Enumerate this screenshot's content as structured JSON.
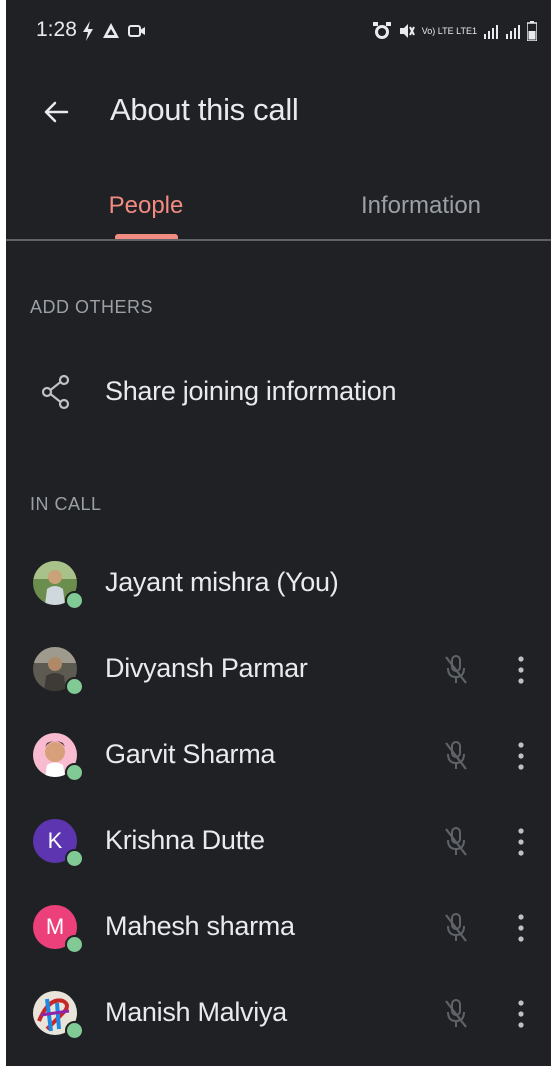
{
  "status_bar": {
    "time": "1:28",
    "network_label": "Vo) LTE LTE1"
  },
  "app_bar": {
    "title": "About this call",
    "back_icon": "arrow-back-icon"
  },
  "tabs": [
    {
      "label": "People",
      "selected": true
    },
    {
      "label": "Information",
      "selected": false
    }
  ],
  "add_others": {
    "heading": "ADD OTHERS",
    "share_label": "Share joining information",
    "share_icon": "share-icon"
  },
  "in_call": {
    "heading": "IN CALL",
    "participants": [
      {
        "name": "Jayant mishra (You)",
        "avatar": "photo",
        "muted": false,
        "show_menu": false
      },
      {
        "name": "Divyansh Parmar",
        "avatar": "photo",
        "muted": true,
        "show_menu": true
      },
      {
        "name": "Garvit Sharma",
        "avatar": "photo",
        "muted": true,
        "show_menu": true
      },
      {
        "name": "Krishna Dutte",
        "avatar": "K",
        "avatar_color": "#5e35b1",
        "muted": true,
        "show_menu": true
      },
      {
        "name": "Mahesh sharma",
        "avatar": "M",
        "avatar_color": "#ec407a",
        "muted": true,
        "show_menu": true
      },
      {
        "name": "Manish Malviya",
        "avatar": "photo",
        "muted": true,
        "show_menu": true
      }
    ]
  },
  "colors": {
    "background": "#202124",
    "accent": "#f28b82",
    "presence": "#81c995",
    "secondary_text": "#9aa0a6"
  }
}
